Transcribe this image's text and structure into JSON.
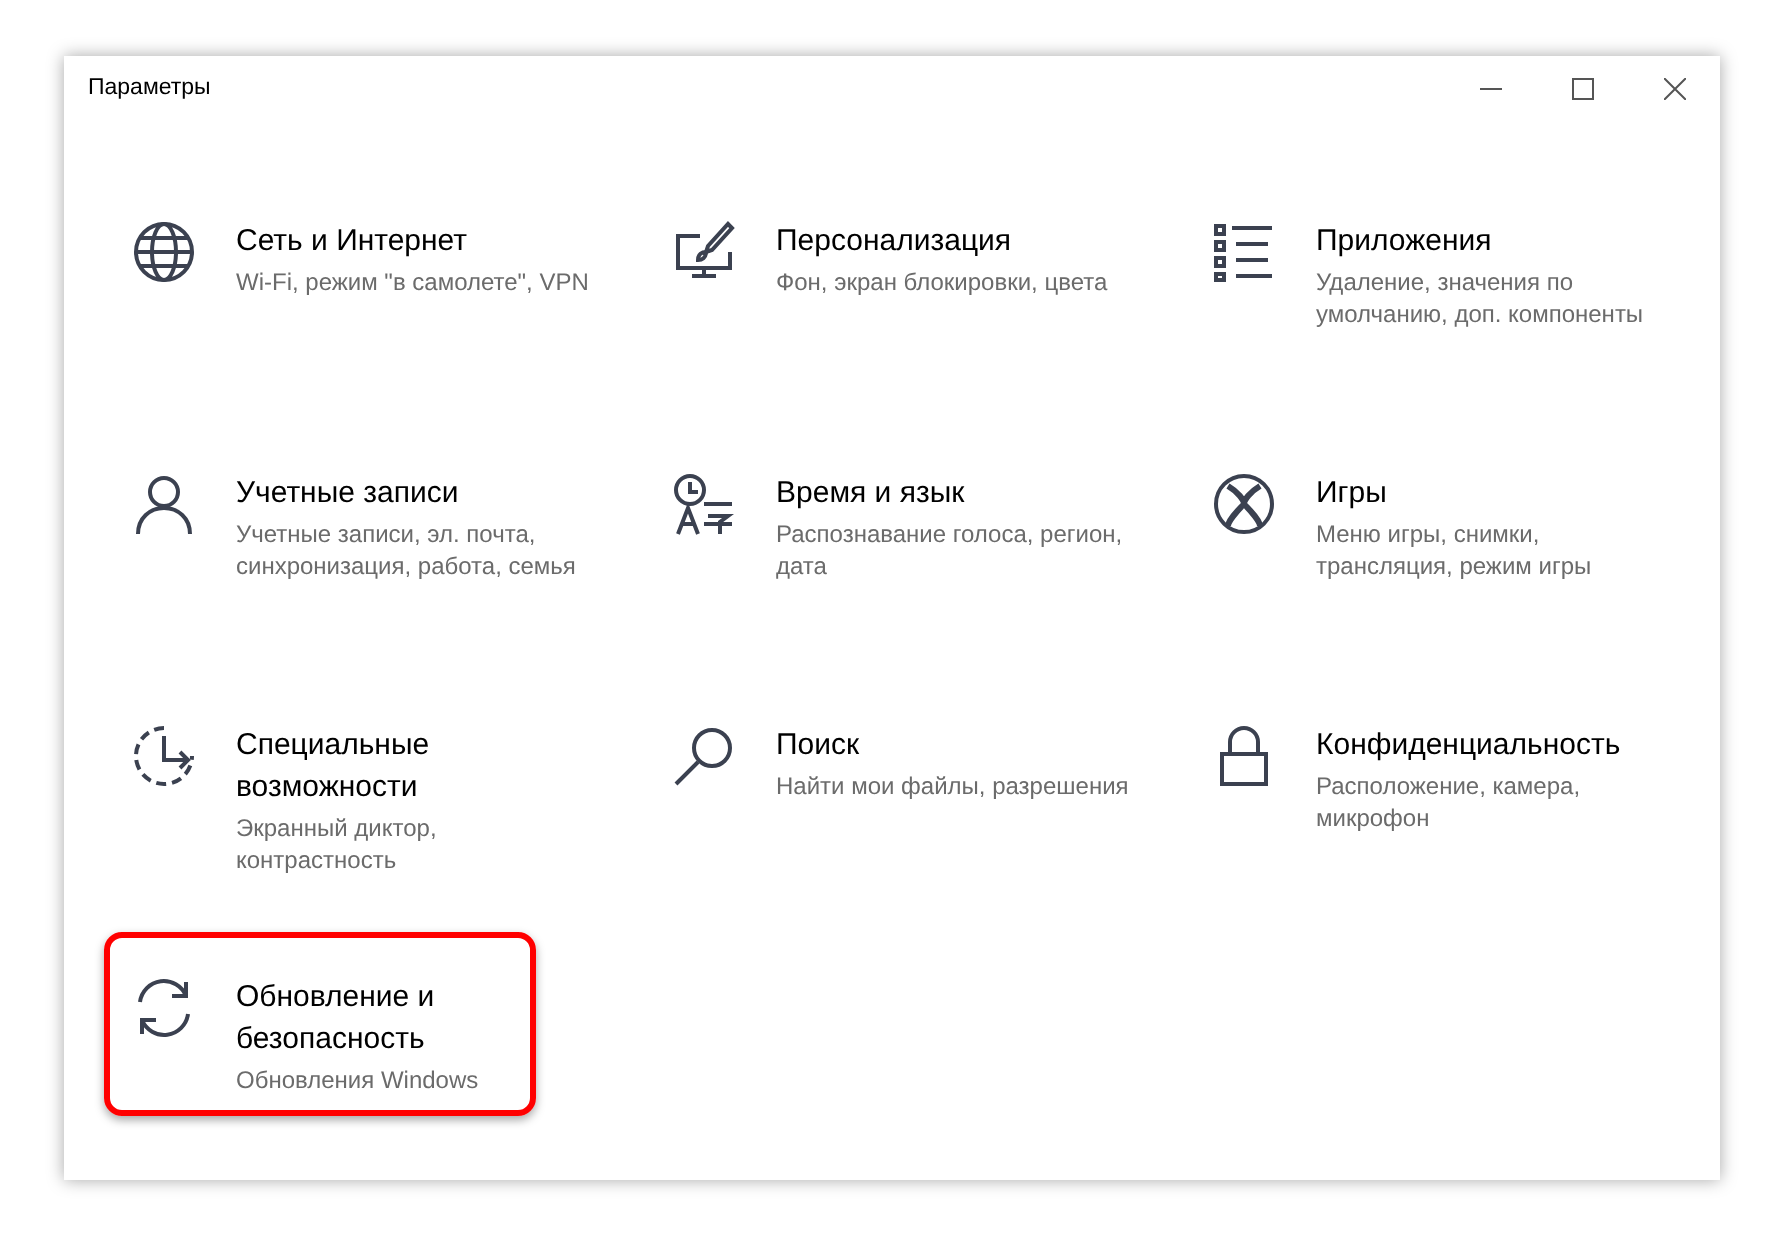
{
  "window": {
    "title": "Параметры"
  },
  "categories": [
    {
      "kind": "globe",
      "title": "Сеть и Интернет",
      "description": "Wi-Fi, режим \"в самолете\", VPN",
      "highlighted": false
    },
    {
      "kind": "brush",
      "title": "Персонализация",
      "description": "Фон, экран блокировки, цвета",
      "highlighted": false
    },
    {
      "kind": "apps",
      "title": "Приложения",
      "description": "Удаление, значения по умолчанию, доп. компоненты",
      "highlighted": false
    },
    {
      "kind": "person",
      "title": "Учетные записи",
      "description": "Учетные записи, эл. почта, синхронизация, работа, семья",
      "highlighted": false
    },
    {
      "kind": "time-language",
      "title": "Время и язык",
      "description": "Распознавание голоса, регион, дата",
      "highlighted": false
    },
    {
      "kind": "gaming",
      "title": "Игры",
      "description": "Меню игры, снимки, трансляция, режим игры",
      "highlighted": false
    },
    {
      "kind": "accessibility",
      "title": "Специальные возможности",
      "description": "Экранный диктор, контрастность",
      "highlighted": false
    },
    {
      "kind": "search",
      "title": "Поиск",
      "description": "Найти мои файлы, разрешения",
      "highlighted": false
    },
    {
      "kind": "lock",
      "title": "Конфиденциальность",
      "description": "Расположение, камера, микрофон",
      "highlighted": false
    },
    {
      "kind": "sync",
      "title": "Обновление и безопасность",
      "description": "Обновления Windows",
      "highlighted": true
    }
  ]
}
